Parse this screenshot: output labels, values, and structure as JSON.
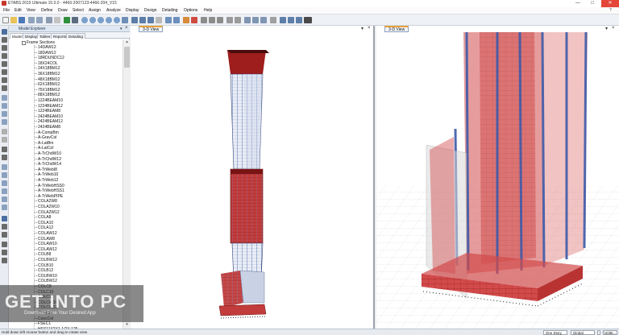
{
  "window": {
    "title": "ETABS 2015 Ultimate 15.0.0 - 4466-2007123-4466-204_V15",
    "controls": [
      "—",
      "□",
      "✕"
    ]
  },
  "menu": {
    "items": [
      "File",
      "Edit",
      "View",
      "Define",
      "Draw",
      "Select",
      "Assign",
      "Analyze",
      "Display",
      "Design",
      "Detailing",
      "Options",
      "Help"
    ],
    "right": "?"
  },
  "explorer": {
    "title": "Model Explorer",
    "tabs": [
      "Model",
      "Display",
      "Tables",
      "Reports",
      "Detailing"
    ],
    "root": "Frame Sections",
    "items": [
      "14DAW12",
      "18DAW12",
      "18RDUNDC12",
      "18X24COL",
      "24X18BM12",
      "36X18BM12",
      "48X18BM12",
      "62X18BM12",
      "75X18BM12",
      "88X18BM12",
      "1224BEAM10",
      "1224BEAM12",
      "1224BEAM8",
      "2424BEAM10",
      "2424BEAM12",
      "2424BEAM8",
      "A-CompBm",
      "A-GravCol",
      "A-LatBm",
      "A-LatCol",
      "A-TrChdW10",
      "A-TrChdW12",
      "A-TrChdW14",
      "A-TrWebI8",
      "A-TrWeb10",
      "A-TrWeb12",
      "A-TrWebHSS0",
      "A-TrWebHSS1",
      "A-TrWebPIPE",
      "COLA2W8",
      "COLA2W10",
      "COLA2W12",
      "COLA8",
      "COLA10",
      "COLA12",
      "COLAW12",
      "COLAW8",
      "COLAW10",
      "COLAW12",
      "COLB8",
      "COLBW12",
      "COLB10",
      "COLB12",
      "COLBW10",
      "COLBW12",
      "COLC8",
      "COLC10",
      "COLC12",
      "COLCW10",
      "COLCW12",
      "ConcBm",
      "ConcCol",
      "FSEC1",
      "HSS11X2X1-1/2X.125"
    ]
  },
  "views": {
    "left": {
      "tab": "3-D View"
    },
    "right": {
      "tab": "3-D View"
    }
  },
  "watermark": {
    "text": "GET INTO PC",
    "subtext": "Download Free Your Desired App"
  },
  "status": {
    "message": "Hold down left mouse button and drag to rotate view",
    "story_select": "One Story",
    "coord_select": "Global",
    "snap_button": "",
    "units_button": "Units..."
  },
  "colors": {
    "accent": "#d8332f",
    "panel_header": "#dfe7f2",
    "tab_highlight": "#e8a23a"
  }
}
